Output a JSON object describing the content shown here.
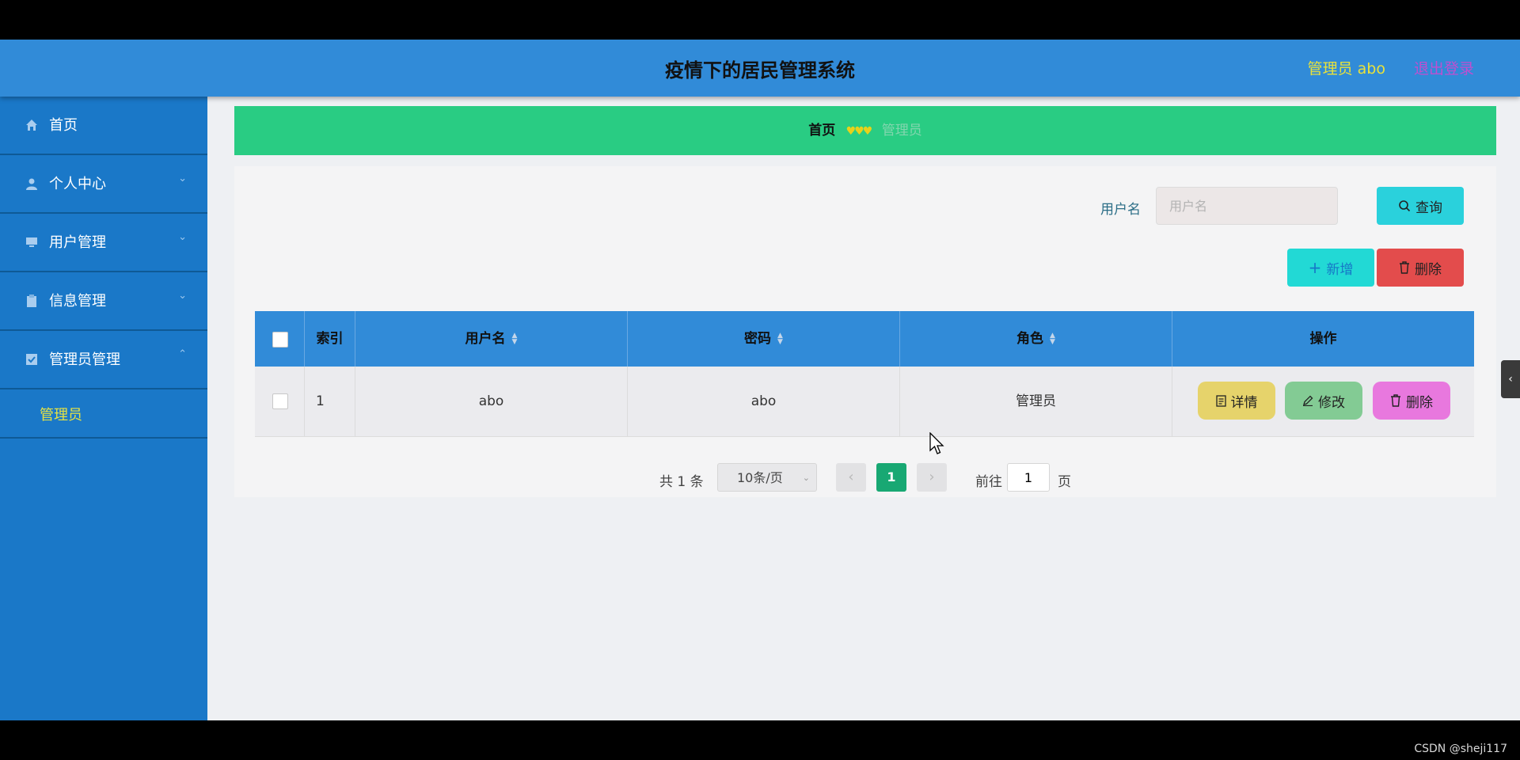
{
  "header": {
    "title": "疫情下的居民管理系统",
    "user": "管理员 abo",
    "logout": "退出登录"
  },
  "sidebar": {
    "items": [
      {
        "label": "首页",
        "icon": "home-icon"
      },
      {
        "label": "个人中心",
        "icon": "user-icon"
      },
      {
        "label": "用户管理",
        "icon": "monitor-icon"
      },
      {
        "label": "信息管理",
        "icon": "clipboard-icon"
      },
      {
        "label": "管理员管理",
        "icon": "checkbox-icon"
      }
    ],
    "active_sub": "管理员"
  },
  "breadcrumb": {
    "home": "首页",
    "current": "管理员"
  },
  "search": {
    "label": "用户名",
    "placeholder": "用户名",
    "query_button": "查询"
  },
  "actions": {
    "add": "新增",
    "delete": "删除"
  },
  "table": {
    "columns": [
      "索引",
      "用户名",
      "密码",
      "角色",
      "操作"
    ],
    "rows": [
      {
        "index": "1",
        "username": "abo",
        "password": "abo",
        "role": "管理员"
      }
    ],
    "row_buttons": {
      "detail": "详情",
      "edit": "修改",
      "delete": "删除"
    }
  },
  "pagination": {
    "total": "共 1 条",
    "page_size": "10条/页",
    "current_page": "1",
    "goto_label": "前往",
    "goto_value": "1",
    "page_unit": "页"
  },
  "watermark": "CSDN @sheji117",
  "colors": {
    "header": "#318bd8",
    "sidebar": "#1a78c8",
    "breadcrumb": "#29cc83",
    "pager_active": "#18a873"
  }
}
